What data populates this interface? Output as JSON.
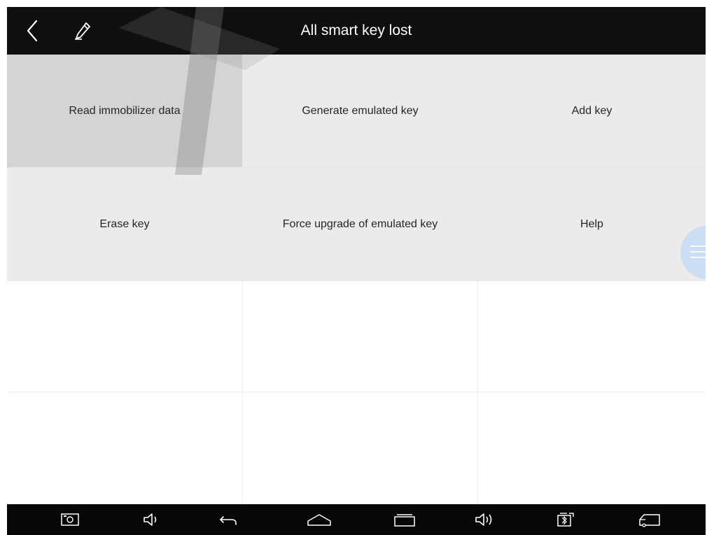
{
  "header": {
    "title": "All smart key lost",
    "back_icon": "chevron-left-icon",
    "edit_icon": "pencil-icon"
  },
  "menu": {
    "items": [
      {
        "label": "Read immobilizer data",
        "state": "pressed"
      },
      {
        "label": "Generate emulated key",
        "state": "normal"
      },
      {
        "label": "Add key",
        "state": "normal"
      },
      {
        "label": "Erase key",
        "state": "normal"
      },
      {
        "label": "Force upgrade of emulated key",
        "state": "normal"
      },
      {
        "label": "Help",
        "state": "normal"
      }
    ]
  },
  "navbar": {
    "icons": [
      "screenshot-icon",
      "volume-down-icon",
      "back-icon",
      "home-icon",
      "recent-apps-icon",
      "volume-up-icon",
      "vci-connection-icon",
      "vehicle-icon"
    ]
  },
  "colors": {
    "header_bg": "#0f0f0f",
    "tile_bg": "#ebebeb",
    "tile_pressed_bg": "#d4d4d4",
    "navbar_bg": "#070707",
    "float_handle": "#c7def5"
  }
}
